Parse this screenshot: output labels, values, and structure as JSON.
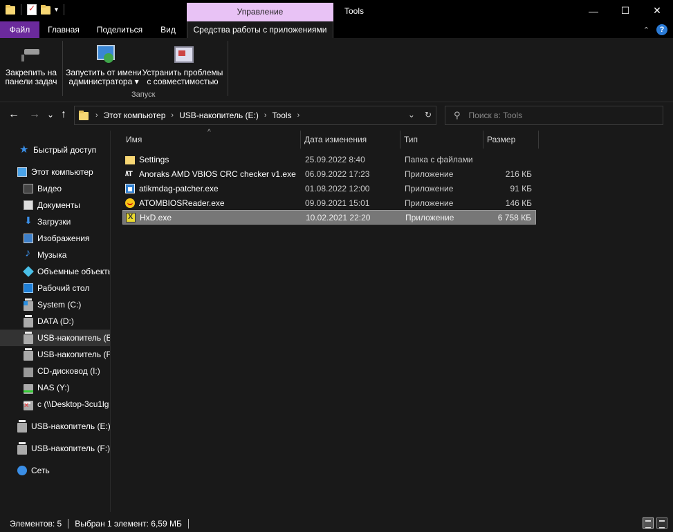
{
  "window": {
    "title": "Tools",
    "contextual_tab_group": "Управление",
    "controls": {
      "minimize": "—",
      "maximize": "☐",
      "close": "✕"
    }
  },
  "ribbon": {
    "tabs": {
      "file": "Файл",
      "home": "Главная",
      "share": "Поделиться",
      "view": "Вид",
      "app_tools": "Средства работы с приложениями"
    },
    "buttons": {
      "pin_line1": "Закрепить на",
      "pin_line2": "панели задач",
      "run_admin_line1": "Запустить от имени",
      "run_admin_line2": "администратора ▾",
      "troubleshoot_line1": "Устранить проблемы",
      "troubleshoot_line2": "с совместимостью"
    },
    "group_label": "Запуск",
    "collapse_glyph": "⌃",
    "help_glyph": "?"
  },
  "address": {
    "crumbs": [
      "Этот компьютер",
      "USB-накопитель (E:)",
      "Tools"
    ],
    "dropdown_glyph": "⌄",
    "refresh_glyph": "↻",
    "search_placeholder": "Поиск в: Tools"
  },
  "nav": {
    "back": "←",
    "forward": "→",
    "recent": "⌄",
    "up": "↑"
  },
  "sidebar": {
    "items": [
      {
        "label": "Быстрый доступ"
      },
      {
        "label": "Этот компьютер"
      },
      {
        "label": "Видео"
      },
      {
        "label": "Документы"
      },
      {
        "label": "Загрузки"
      },
      {
        "label": "Изображения"
      },
      {
        "label": "Музыка"
      },
      {
        "label": "Объемные объекты"
      },
      {
        "label": "Рабочий стол"
      },
      {
        "label": "System (C:)"
      },
      {
        "label": "DATA (D:)"
      },
      {
        "label": "USB-накопитель (E:)"
      },
      {
        "label": "USB-накопитель (F:)"
      },
      {
        "label": "CD-дисковод (I:)"
      },
      {
        "label": "NAS (Y:)"
      },
      {
        "label": "c (\\\\Desktop-3cu1lg"
      },
      {
        "label": "USB-накопитель (E:)"
      },
      {
        "label": "USB-накопитель (F:)"
      },
      {
        "label": "Сеть"
      }
    ]
  },
  "columns": {
    "name": "Имя",
    "modified": "Дата изменения",
    "type": "Тип",
    "size": "Размер",
    "sort_glyph": "^"
  },
  "files": [
    {
      "name": "Settings",
      "date": "25.09.2022 8:40",
      "type": "Папка с файлами",
      "size": ""
    },
    {
      "name": "Anoraks AMD VBIOS CRC checker v1.exe",
      "date": "06.09.2022 17:23",
      "type": "Приложение",
      "size": "216 КБ"
    },
    {
      "name": "atikmdag-patcher.exe",
      "date": "01.08.2022 12:00",
      "type": "Приложение",
      "size": "91 КБ"
    },
    {
      "name": "ATOMBIOSReader.exe",
      "date": "09.09.2021 15:01",
      "type": "Приложение",
      "size": "146 КБ"
    },
    {
      "name": "HxD.exe",
      "date": "10.02.2021 22:20",
      "type": "Приложение",
      "size": "6 758 КБ"
    }
  ],
  "status": {
    "items_count": "Элементов: 5",
    "selection": "Выбран 1 элемент: 6,59 МБ"
  }
}
